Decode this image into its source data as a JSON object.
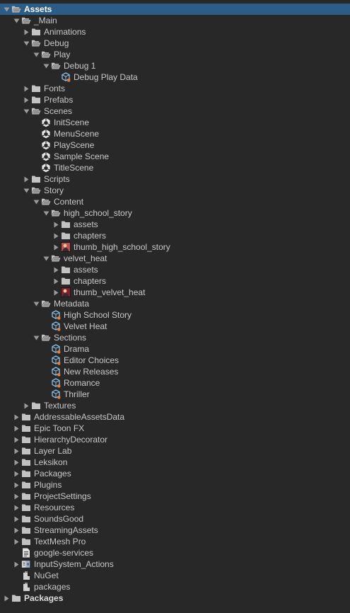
{
  "items": [
    {
      "label": "Assets",
      "depth": 0,
      "toggle": "open",
      "icon": "folder-open-icon",
      "bold": true,
      "selected": true
    },
    {
      "label": "_Main",
      "depth": 1,
      "toggle": "open",
      "icon": "folder-open-icon"
    },
    {
      "label": "Animations",
      "depth": 2,
      "toggle": "closed",
      "icon": "folder-icon"
    },
    {
      "label": "Debug",
      "depth": 2,
      "toggle": "open",
      "icon": "folder-open-icon"
    },
    {
      "label": "Play",
      "depth": 3,
      "toggle": "open",
      "icon": "folder-open-icon"
    },
    {
      "label": "Debug 1",
      "depth": 4,
      "toggle": "open",
      "icon": "folder-open-icon"
    },
    {
      "label": "Debug Play Data",
      "depth": 5,
      "toggle": "none",
      "icon": "scriptable-object-icon"
    },
    {
      "label": "Fonts",
      "depth": 2,
      "toggle": "closed",
      "icon": "folder-icon"
    },
    {
      "label": "Prefabs",
      "depth": 2,
      "toggle": "closed",
      "icon": "folder-icon"
    },
    {
      "label": "Scenes",
      "depth": 2,
      "toggle": "open",
      "icon": "folder-open-icon"
    },
    {
      "label": "InitScene",
      "depth": 3,
      "toggle": "none",
      "icon": "unity-scene-icon"
    },
    {
      "label": "MenuScene",
      "depth": 3,
      "toggle": "none",
      "icon": "unity-scene-icon"
    },
    {
      "label": "PlayScene",
      "depth": 3,
      "toggle": "none",
      "icon": "unity-scene-icon"
    },
    {
      "label": "Sample Scene",
      "depth": 3,
      "toggle": "none",
      "icon": "unity-scene-icon"
    },
    {
      "label": "TitleScene",
      "depth": 3,
      "toggle": "none",
      "icon": "unity-scene-icon"
    },
    {
      "label": "Scripts",
      "depth": 2,
      "toggle": "closed",
      "icon": "folder-icon"
    },
    {
      "label": "Story",
      "depth": 2,
      "toggle": "open",
      "icon": "folder-open-icon"
    },
    {
      "label": "Content",
      "depth": 3,
      "toggle": "open",
      "icon": "folder-open-icon"
    },
    {
      "label": "high_school_story",
      "depth": 4,
      "toggle": "open",
      "icon": "folder-open-icon"
    },
    {
      "label": "assets",
      "depth": 5,
      "toggle": "closed",
      "icon": "folder-icon"
    },
    {
      "label": "chapters",
      "depth": 5,
      "toggle": "closed",
      "icon": "folder-icon"
    },
    {
      "label": "thumb_high_school_story",
      "depth": 5,
      "toggle": "closed",
      "icon": "image-thumbnail-icon",
      "thumb": "#c0504d"
    },
    {
      "label": "velvet_heat",
      "depth": 4,
      "toggle": "open",
      "icon": "folder-open-icon"
    },
    {
      "label": "assets",
      "depth": 5,
      "toggle": "closed",
      "icon": "folder-icon"
    },
    {
      "label": "chapters",
      "depth": 5,
      "toggle": "closed",
      "icon": "folder-icon"
    },
    {
      "label": "thumb_velvet_heat",
      "depth": 5,
      "toggle": "closed",
      "icon": "image-thumbnail-icon",
      "thumb": "#8a1e2b"
    },
    {
      "label": "Metadata",
      "depth": 3,
      "toggle": "open",
      "icon": "folder-open-icon"
    },
    {
      "label": "High School Story",
      "depth": 4,
      "toggle": "none",
      "icon": "scriptable-object-icon"
    },
    {
      "label": "Velvet Heat",
      "depth": 4,
      "toggle": "none",
      "icon": "scriptable-object-icon"
    },
    {
      "label": "Sections",
      "depth": 3,
      "toggle": "open",
      "icon": "folder-open-icon"
    },
    {
      "label": "Drama",
      "depth": 4,
      "toggle": "none",
      "icon": "scriptable-object-icon"
    },
    {
      "label": "Editor Choices",
      "depth": 4,
      "toggle": "none",
      "icon": "scriptable-object-icon"
    },
    {
      "label": "New Releases",
      "depth": 4,
      "toggle": "none",
      "icon": "scriptable-object-icon"
    },
    {
      "label": "Romance",
      "depth": 4,
      "toggle": "none",
      "icon": "scriptable-object-icon"
    },
    {
      "label": "Thriller",
      "depth": 4,
      "toggle": "none",
      "icon": "scriptable-object-icon"
    },
    {
      "label": "Textures",
      "depth": 2,
      "toggle": "closed",
      "icon": "folder-icon"
    },
    {
      "label": "AddressableAssetsData",
      "depth": 1,
      "toggle": "closed",
      "icon": "folder-icon"
    },
    {
      "label": "Epic Toon FX",
      "depth": 1,
      "toggle": "closed",
      "icon": "folder-icon"
    },
    {
      "label": "HierarchyDecorator",
      "depth": 1,
      "toggle": "closed",
      "icon": "folder-icon"
    },
    {
      "label": "Layer Lab",
      "depth": 1,
      "toggle": "closed",
      "icon": "folder-icon"
    },
    {
      "label": "Leksikon",
      "depth": 1,
      "toggle": "closed",
      "icon": "folder-icon"
    },
    {
      "label": "Packages",
      "depth": 1,
      "toggle": "closed",
      "icon": "folder-icon"
    },
    {
      "label": "Plugins",
      "depth": 1,
      "toggle": "closed",
      "icon": "folder-icon"
    },
    {
      "label": "ProjectSettings",
      "depth": 1,
      "toggle": "closed",
      "icon": "folder-icon"
    },
    {
      "label": "Resources",
      "depth": 1,
      "toggle": "closed",
      "icon": "folder-icon"
    },
    {
      "label": "SoundsGood",
      "depth": 1,
      "toggle": "closed",
      "icon": "folder-icon"
    },
    {
      "label": "StreamingAssets",
      "depth": 1,
      "toggle": "closed",
      "icon": "folder-icon"
    },
    {
      "label": "TextMesh Pro",
      "depth": 1,
      "toggle": "closed",
      "icon": "folder-icon"
    },
    {
      "label": "google-services",
      "depth": 1,
      "toggle": "none",
      "icon": "text-file-icon"
    },
    {
      "label": "InputSystem_Actions",
      "depth": 1,
      "toggle": "closed",
      "icon": "input-actions-icon"
    },
    {
      "label": "NuGet",
      "depth": 1,
      "toggle": "none",
      "icon": "config-file-icon"
    },
    {
      "label": "packages",
      "depth": 1,
      "toggle": "none",
      "icon": "config-file-icon"
    },
    {
      "label": "Packages",
      "depth": 0,
      "toggle": "closed",
      "icon": "folder-icon",
      "bold": true
    }
  ],
  "colors": {
    "background": "#282828",
    "selection": "#2c5d87",
    "text": "#c8c8c8",
    "folder": "#c2c2c2",
    "arrow": "#9a9a9a",
    "scriptable": "#8fc3ea"
  }
}
